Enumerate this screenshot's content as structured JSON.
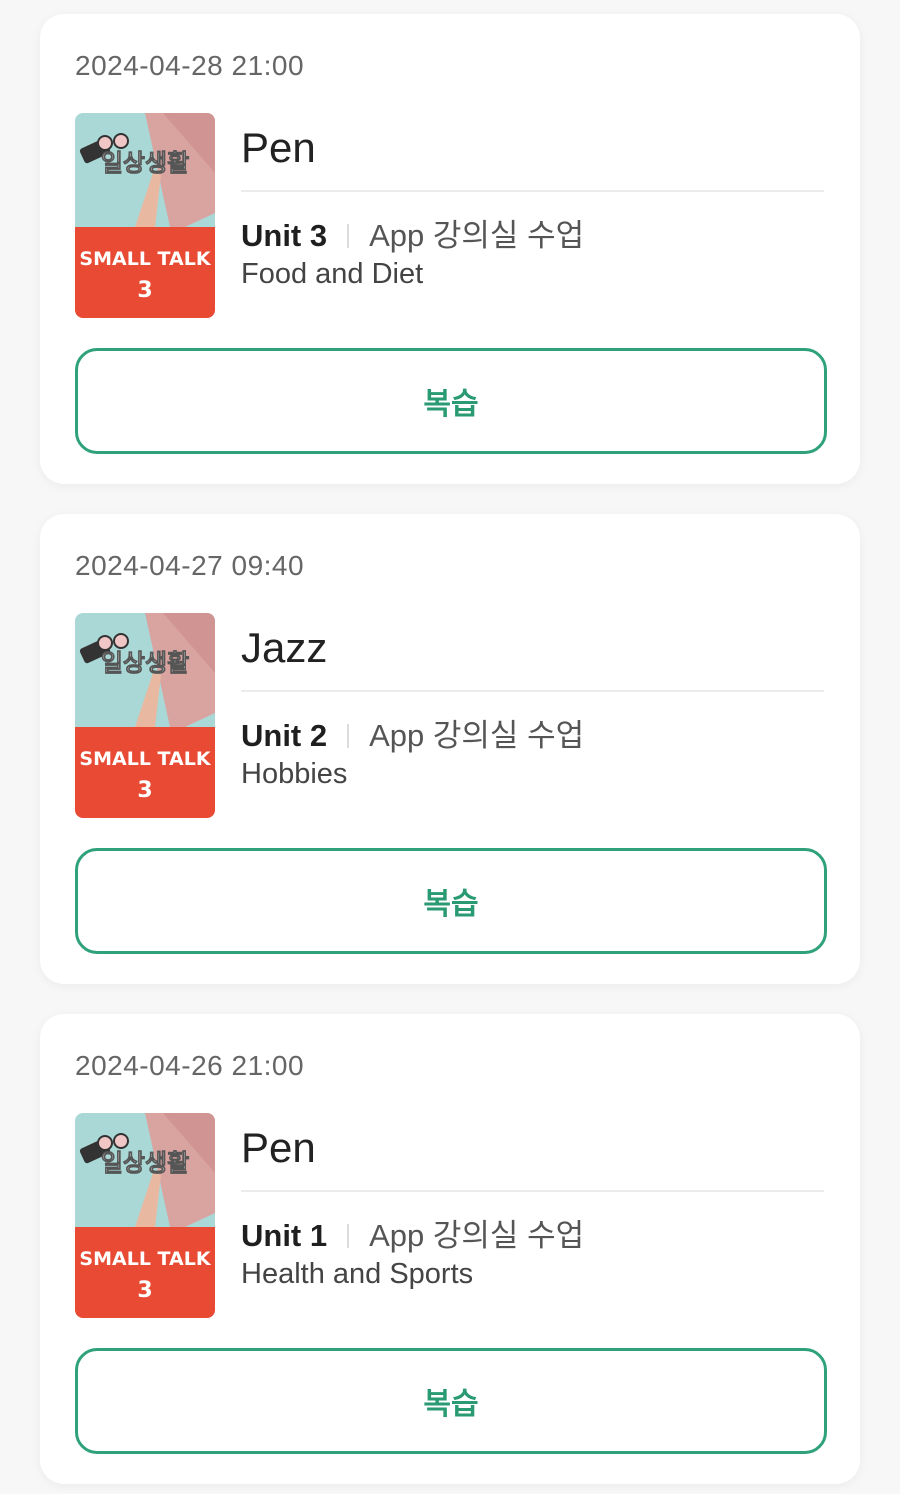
{
  "lessons": [
    {
      "datetime": "2024-04-28 21:00",
      "teacher": "Pen",
      "unit": "Unit 3",
      "mode": "App 강의실 수업",
      "topic": "Food and Diet",
      "button_label": "복습",
      "thumbnail": {
        "top_text": "일상생활",
        "bottom_line1": "SMALL TALK",
        "bottom_line2": "3"
      }
    },
    {
      "datetime": "2024-04-27 09:40",
      "teacher": "Jazz",
      "unit": "Unit 2",
      "mode": "App 강의실 수업",
      "topic": "Hobbies",
      "button_label": "복습",
      "thumbnail": {
        "top_text": "일상생활",
        "bottom_line1": "SMALL TALK",
        "bottom_line2": "3"
      }
    },
    {
      "datetime": "2024-04-26 21:00",
      "teacher": "Pen",
      "unit": "Unit 1",
      "mode": "App 강의실 수업",
      "topic": "Health and Sports",
      "button_label": "복습",
      "thumbnail": {
        "top_text": "일상생활",
        "bottom_line1": "SMALL TALK",
        "bottom_line2": "3"
      }
    }
  ],
  "colors": {
    "accent": "#2fa27a",
    "thumb_sky": "#a9d8d7",
    "thumb_red": "#e84a33"
  }
}
